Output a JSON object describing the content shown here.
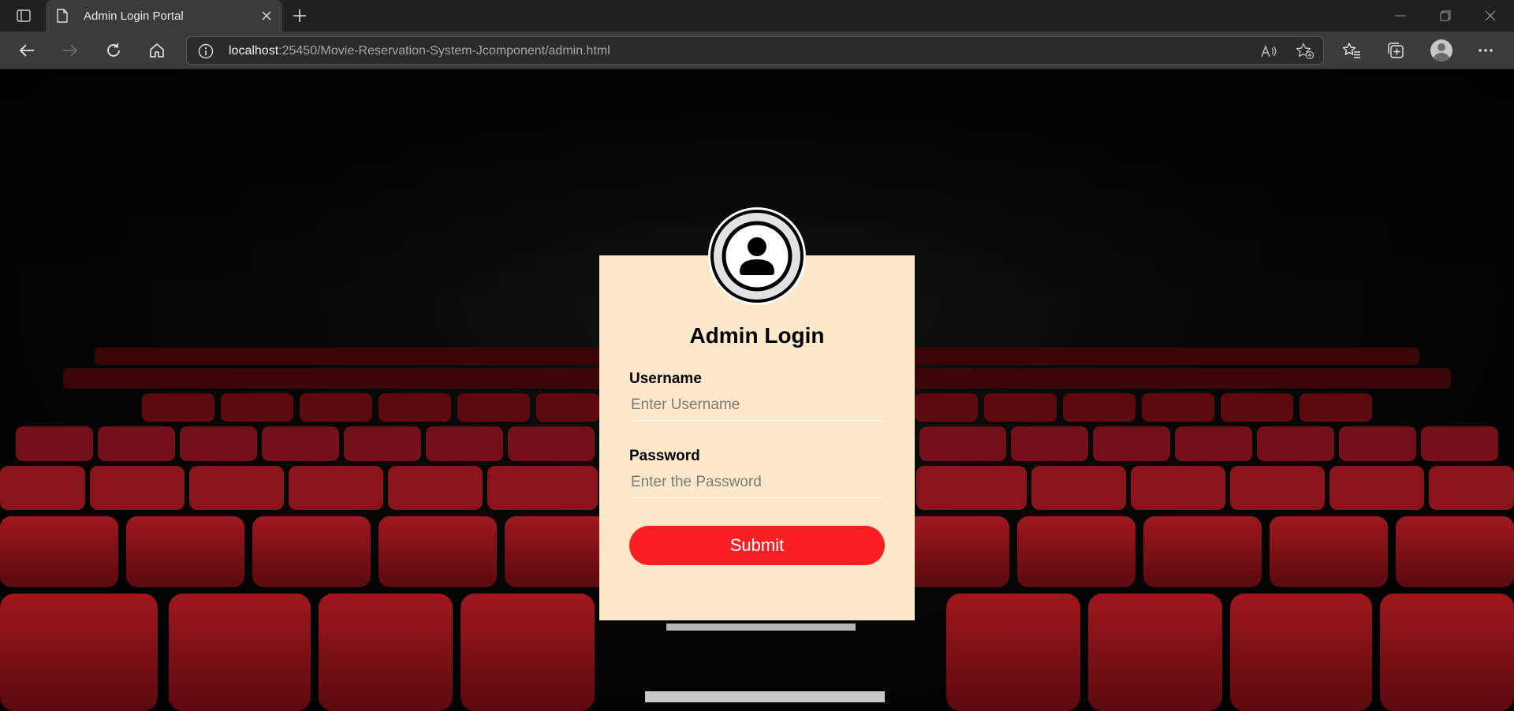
{
  "browser": {
    "tab_title": "Admin Login Portal",
    "url_host": "localhost",
    "url_path": ":25450/Movie-Reservation-System-Jcomponent/admin.html",
    "icons": [
      "tab-actions-icon",
      "document-icon",
      "close-icon",
      "new-tab-icon",
      "minimize-icon",
      "restore-icon",
      "window-close-icon",
      "back-icon",
      "forward-icon",
      "refresh-icon",
      "home-icon",
      "info-icon",
      "read-aloud-icon",
      "add-favorite-icon",
      "favorites-icon",
      "collections-icon",
      "profile-avatar",
      "more-icon"
    ]
  },
  "login": {
    "title": "Admin Login",
    "username_label": "Username",
    "username_placeholder": "Enter Username",
    "password_label": "Password",
    "password_placeholder": "Enter the Password",
    "submit_label": "Submit"
  },
  "colors": {
    "card_background": "#fde9c9",
    "submit_button": "#fb1f24",
    "seat_red": "#8e1318"
  }
}
